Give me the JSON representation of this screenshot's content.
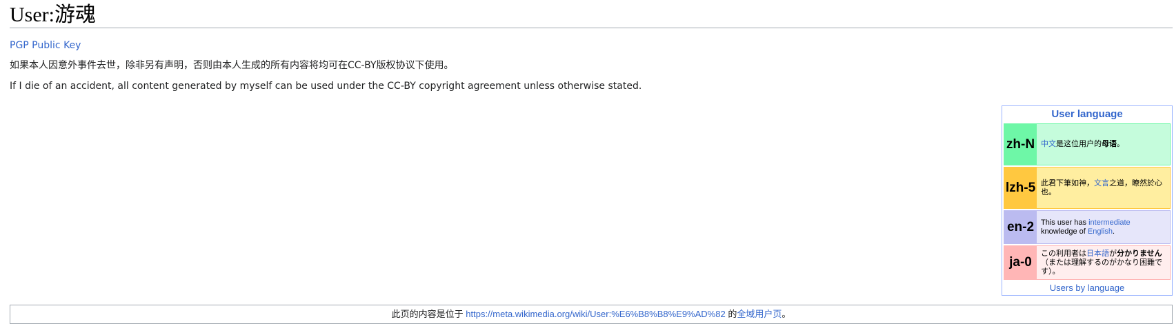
{
  "page": {
    "title": "User:游魂"
  },
  "content": {
    "pgp_link": "PGP Public Key",
    "statement_zh": "如果本人因意外事件去世，除非另有声明，否则由本人生成的所有内容将均可在CC-BY版权协议下使用。",
    "statement_en": "If I die of an accident, all content generated by myself can be used under the CC-BY copyright agreement unless otherwise stated."
  },
  "babel": {
    "title": "User language",
    "footer_link": "Users by language",
    "zh": {
      "code": "zh-N",
      "link": "中文",
      "text1": "是这位用户的",
      "bold": "母语",
      "text2": "。"
    },
    "lzh": {
      "code": "lzh-5",
      "text1": "此君下筆如神，",
      "link": "文言",
      "text2": "之道，瞭然於心也。"
    },
    "en": {
      "code": "en-2",
      "text1": "This user has ",
      "link1": "intermediate",
      "text2": " knowledge of ",
      "link2": "English",
      "text3": "."
    },
    "ja": {
      "code": "ja-0",
      "text1": "この利用者は",
      "link": "日本語",
      "text2": "が",
      "bold": "分かりません",
      "text3": "（または理解するのがかなり困難です）。"
    }
  },
  "notice": {
    "prefix": "此页的内容是位于 ",
    "url": "https://meta.wikimedia.org/wiki/User:%E6%B8%B8%E9%AD%82",
    "middle": " 的",
    "link": "全域用户页",
    "suffix": "。"
  },
  "colors": {
    "link": "#3366cc",
    "zh_code": "#6ef7a7",
    "zh_bg": "#c5fcdc",
    "lzh_code": "#ffc840",
    "lzh_bg": "#ffeea0",
    "en_code": "#bbbbf0",
    "en_bg": "#e6e6fa",
    "ja_code": "#ffb6b6",
    "ja_bg": "#ffeeee",
    "babel_border": "#99b3ff"
  }
}
